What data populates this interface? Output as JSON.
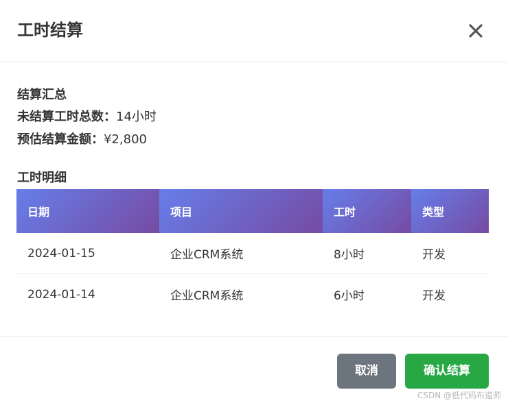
{
  "modal": {
    "title": "工时结算",
    "close_icon": "close-icon"
  },
  "summary": {
    "heading": "结算汇总",
    "unsettled_label": "未结算工时总数：",
    "unsettled_value": "14小时",
    "estimate_label": "预估结算金额：",
    "estimate_value": "¥2,800"
  },
  "detail": {
    "heading": "工时明细",
    "columns": [
      "日期",
      "项目",
      "工时",
      "类型"
    ],
    "rows": [
      [
        "2024-01-15",
        "企业CRM系统",
        "8小时",
        "开发"
      ],
      [
        "2024-01-14",
        "企业CRM系统",
        "6小时",
        "开发"
      ]
    ],
    "header_gradient": [
      "#667eea",
      "#764ba2"
    ]
  },
  "footer": {
    "cancel_label": "取消",
    "confirm_label": "确认结算",
    "cancel_color": "#6c757d",
    "confirm_color": "#28a745"
  },
  "watermark": "CSDN @低代码布道师"
}
